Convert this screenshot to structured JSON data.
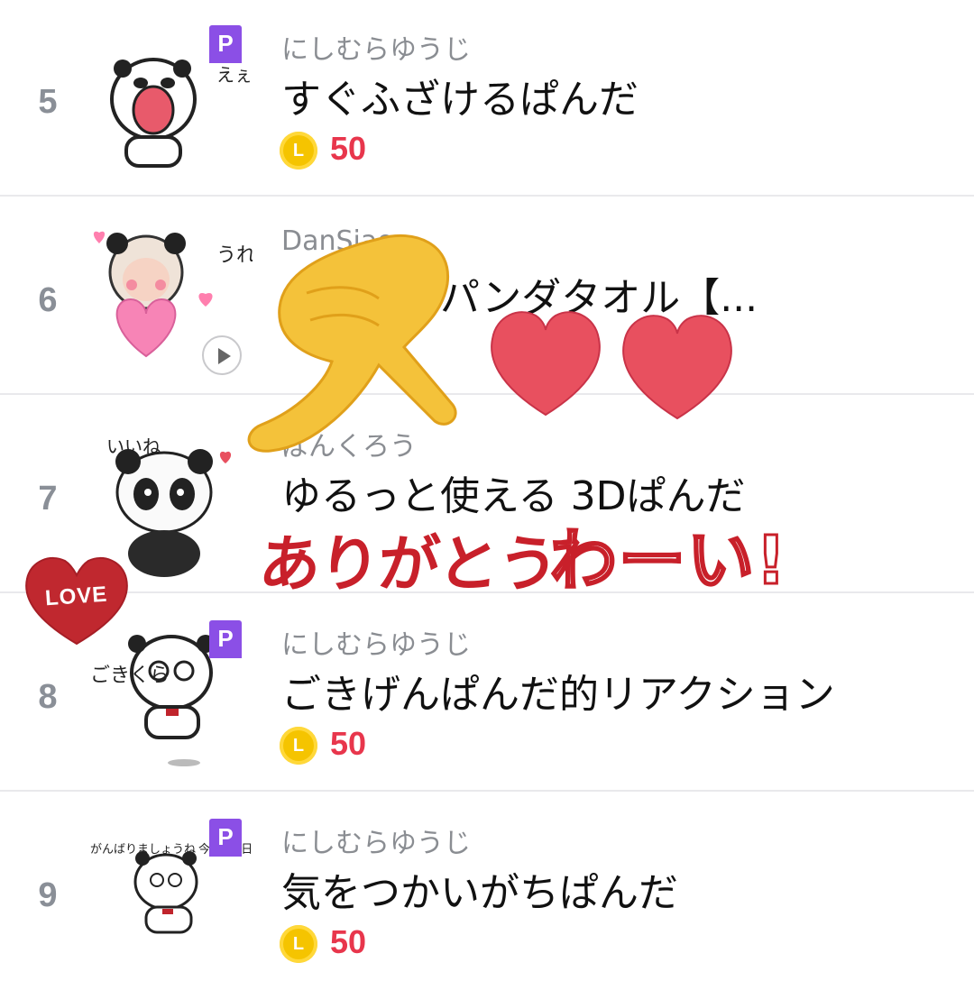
{
  "items": [
    {
      "rank": "5",
      "creator": "にしむらゆうじ",
      "title": "すぐふざけるぱんだ",
      "premium_badge": "P",
      "price": "50"
    },
    {
      "rank": "6",
      "creator": "DanSiao",
      "title": "【うを】パンダタオル【...",
      "premium_badge": "",
      "price": ""
    },
    {
      "rank": "7",
      "creator": "ぱんくろう",
      "title": "ゆるっと使える 3Dぱんだ",
      "premium_badge": "",
      "price": ""
    },
    {
      "rank": "8",
      "creator": "にしむらゆうじ",
      "title": "ごきげんぱんだ的リアクション",
      "premium_badge": "P",
      "price": "50"
    },
    {
      "rank": "9",
      "creator": "にしむらゆうじ",
      "title": "気をつかいがちぱんだ",
      "premium_badge": "P",
      "price": "50"
    }
  ],
  "coin_symbol": "L",
  "sticker_texts": {
    "item5": "えぇ〜",
    "item6": "うれしい",
    "item7": "いいね",
    "item8": "ごきくら",
    "item9a": "がんばりましょうね",
    "item9b": "今日も1日"
  },
  "overlay": {
    "love_label": "LOVE",
    "arigatou": "ありがとう",
    "waai": "わーい!"
  },
  "colors": {
    "price": "#e8364c",
    "premium": "#8b4fe6",
    "coin": "#f5c400",
    "heart": "#e8505f",
    "rank": "#8a8f97"
  }
}
